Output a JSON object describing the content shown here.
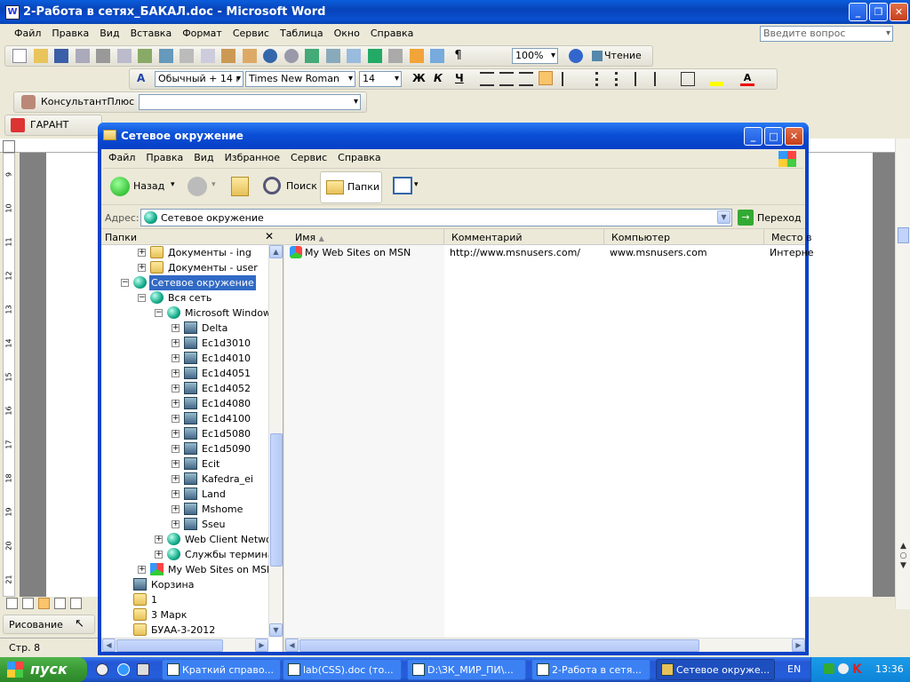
{
  "word": {
    "title": "2-Работа в сетях_БАКАЛ.doc - Microsoft Word",
    "menu": [
      "Файл",
      "Правка",
      "Вид",
      "Вставка",
      "Формат",
      "Сервис",
      "Таблица",
      "Окно",
      "Справка"
    ],
    "question_placeholder": "Введите вопрос",
    "zoom": "100%",
    "reading": "Чтение",
    "style": "Обычный + 14 г",
    "font": "Times New Roman",
    "size": "14",
    "bold": "Ж",
    "italic": "К",
    "underline": "Ч",
    "konsultant": "КонсультантПлюс",
    "garant": "ГАРАНТ",
    "drawing": "Рисование",
    "page_status": "Стр. 8",
    "ruler_numbers": [
      "9",
      "10",
      "11",
      "12",
      "13",
      "14",
      "15",
      "16",
      "17",
      "18",
      "19",
      "20",
      "21"
    ]
  },
  "explorer": {
    "title": "Сетевое окружение",
    "menu": [
      "Файл",
      "Правка",
      "Вид",
      "Избранное",
      "Сервис",
      "Справка"
    ],
    "back": "Назад",
    "search": "Поиск",
    "folders": "Папки",
    "address_label": "Адрес:",
    "address": "Сетевое окружение",
    "go": "Переход",
    "folders_pane_title": "Папки",
    "tree": [
      {
        "label": "Документы - ing",
        "level": 2,
        "pm": "+",
        "icon": "folder"
      },
      {
        "label": "Документы - user",
        "level": 2,
        "pm": "+",
        "icon": "folder"
      },
      {
        "label": "Сетевое окружение",
        "level": 1,
        "pm": "−",
        "icon": "net",
        "selected": true
      },
      {
        "label": "Вся сеть",
        "level": 2,
        "pm": "−",
        "icon": "globe"
      },
      {
        "label": "Microsoft Windows Ne",
        "level": 3,
        "pm": "−",
        "icon": "globe"
      },
      {
        "label": "Delta",
        "level": 4,
        "pm": "+",
        "icon": "comp"
      },
      {
        "label": "Ec1d3010",
        "level": 4,
        "pm": "+",
        "icon": "comp"
      },
      {
        "label": "Ec1d4010",
        "level": 4,
        "pm": "+",
        "icon": "comp"
      },
      {
        "label": "Ec1d4051",
        "level": 4,
        "pm": "+",
        "icon": "comp"
      },
      {
        "label": "Ec1d4052",
        "level": 4,
        "pm": "+",
        "icon": "comp"
      },
      {
        "label": "Ec1d4080",
        "level": 4,
        "pm": "+",
        "icon": "comp"
      },
      {
        "label": "Ec1d4100",
        "level": 4,
        "pm": "+",
        "icon": "comp"
      },
      {
        "label": "Ec1d5080",
        "level": 4,
        "pm": "+",
        "icon": "comp"
      },
      {
        "label": "Ec1d5090",
        "level": 4,
        "pm": "+",
        "icon": "comp"
      },
      {
        "label": "Ecit",
        "level": 4,
        "pm": "+",
        "icon": "comp"
      },
      {
        "label": "Kafedra_ei",
        "level": 4,
        "pm": "+",
        "icon": "comp"
      },
      {
        "label": "Land",
        "level": 4,
        "pm": "+",
        "icon": "comp"
      },
      {
        "label": "Mshome",
        "level": 4,
        "pm": "+",
        "icon": "comp"
      },
      {
        "label": "Sseu",
        "level": 4,
        "pm": "+",
        "icon": "comp"
      },
      {
        "label": "Web Client Network",
        "level": 3,
        "pm": "+",
        "icon": "globe"
      },
      {
        "label": "Службы терминалов",
        "level": 3,
        "pm": "+",
        "icon": "globe"
      },
      {
        "label": "My Web Sites on MSN",
        "level": 2,
        "pm": "+",
        "icon": "msn"
      },
      {
        "label": "Корзина",
        "level": 1,
        "pm": "",
        "icon": "bin"
      },
      {
        "label": "1",
        "level": 1,
        "pm": "",
        "icon": "folder"
      },
      {
        "label": "3 Марк",
        "level": 1,
        "pm": "",
        "icon": "folder"
      },
      {
        "label": "БУАА-3-2012",
        "level": 1,
        "pm": "",
        "icon": "folder"
      }
    ],
    "columns": [
      "Имя",
      "Комментарий",
      "Компьютер",
      "Место в"
    ],
    "rows": [
      {
        "name": "My Web Sites on MSN",
        "comment": "http://www.msnusers.com/",
        "computer": "www.msnusers.com",
        "place": "Интерне"
      }
    ]
  },
  "taskbar": {
    "start": "пуск",
    "tasks": [
      "Краткий справо...",
      "lab(CSS).doc (то...",
      "D:\\ЗК_МИР_ПИ\\...",
      "2-Работа в сетя...",
      "Сетевое окруже..."
    ],
    "lang": "EN",
    "time": "13:36"
  }
}
